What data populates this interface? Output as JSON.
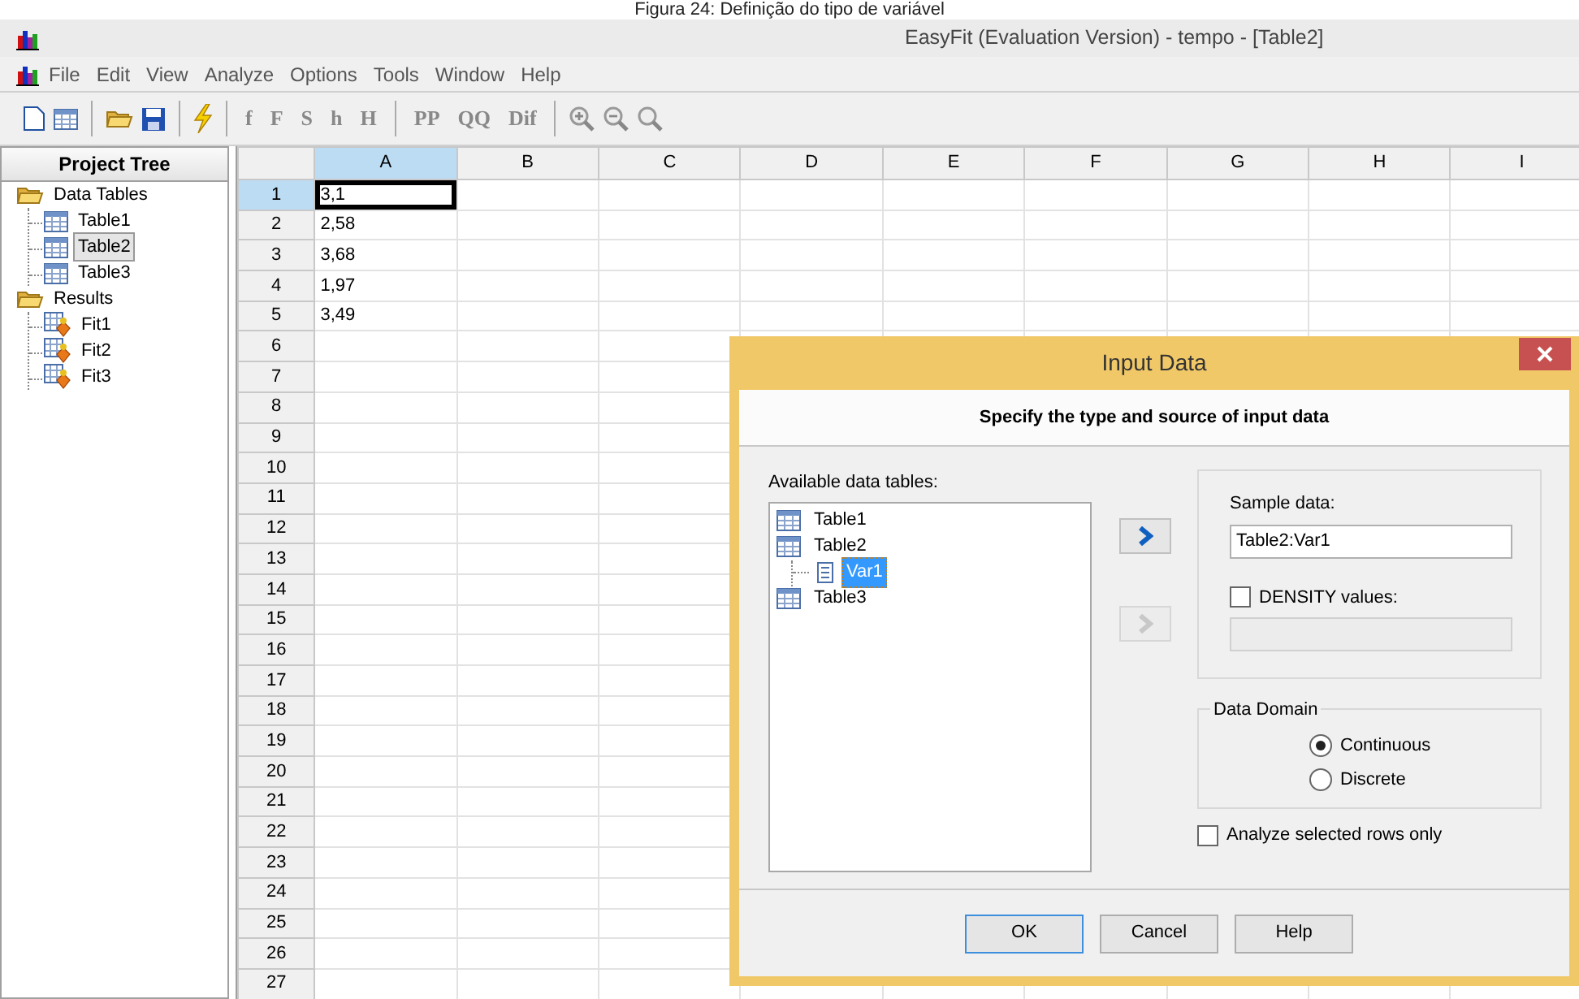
{
  "caption": "Figura 24: Definição do tipo de variável",
  "window": {
    "title": "EasyFit (Evaluation Version) - tempo - [Table2]"
  },
  "menu": [
    "File",
    "Edit",
    "View",
    "Analyze",
    "Options",
    "Tools",
    "Window",
    "Help"
  ],
  "toolbar": [
    {
      "kind": "document"
    },
    {
      "kind": "grid"
    },
    {
      "kind": "separator"
    },
    {
      "kind": "folder"
    },
    {
      "kind": "disk"
    },
    {
      "kind": "separator"
    },
    {
      "kind": "bolt"
    },
    {
      "kind": "separator"
    },
    {
      "kind": "text",
      "label": "f"
    },
    {
      "kind": "text",
      "label": "F"
    },
    {
      "kind": "text",
      "label": "S"
    },
    {
      "kind": "text",
      "label": "h"
    },
    {
      "kind": "text",
      "label": "H"
    },
    {
      "kind": "separator"
    },
    {
      "kind": "text",
      "label": "PP"
    },
    {
      "kind": "text",
      "label": "QQ"
    },
    {
      "kind": "text",
      "label": "Dif"
    },
    {
      "kind": "separator"
    },
    {
      "kind": "zoom-in"
    },
    {
      "kind": "zoom-out"
    },
    {
      "kind": "zoom"
    }
  ],
  "project_tree": {
    "title": "Project Tree",
    "items": [
      {
        "label": "Data Tables",
        "kind": "folder",
        "selected": false,
        "children": [
          {
            "label": "Table1",
            "kind": "table",
            "selected": false
          },
          {
            "label": "Table2",
            "kind": "table",
            "selected": true
          },
          {
            "label": "Table3",
            "kind": "table",
            "selected": false
          }
        ]
      },
      {
        "label": "Results",
        "kind": "folder",
        "selected": false,
        "children": [
          {
            "label": "Fit1",
            "kind": "fit",
            "selected": false
          },
          {
            "label": "Fit2",
            "kind": "fit",
            "selected": false
          },
          {
            "label": "Fit3",
            "kind": "fit",
            "selected": false
          }
        ]
      }
    ]
  },
  "grid": {
    "columns": [
      {
        "label": "A",
        "selected": true
      },
      {
        "label": "B",
        "selected": false
      },
      {
        "label": "C",
        "selected": false
      },
      {
        "label": "D",
        "selected": false
      },
      {
        "label": "E",
        "selected": false
      },
      {
        "label": "F",
        "selected": false
      },
      {
        "label": "G",
        "selected": false
      },
      {
        "label": "H",
        "selected": false
      },
      {
        "label": "I",
        "selected": false
      }
    ],
    "rows": [
      {
        "label": "1",
        "selected": true,
        "cells": [
          "3,1"
        ]
      },
      {
        "label": "2",
        "selected": false,
        "cells": [
          "2,58"
        ]
      },
      {
        "label": "3",
        "selected": false,
        "cells": [
          "3,68"
        ]
      },
      {
        "label": "4",
        "selected": false,
        "cells": [
          "1,97"
        ]
      },
      {
        "label": "5",
        "selected": false,
        "cells": [
          "3,49"
        ]
      },
      {
        "label": "6",
        "selected": false
      },
      {
        "label": "7",
        "selected": false
      },
      {
        "label": "8",
        "selected": false
      },
      {
        "label": "9",
        "selected": false
      },
      {
        "label": "10",
        "selected": false
      },
      {
        "label": "11",
        "selected": false
      },
      {
        "label": "12",
        "selected": false
      },
      {
        "label": "13",
        "selected": false
      },
      {
        "label": "14",
        "selected": false
      },
      {
        "label": "15",
        "selected": false
      },
      {
        "label": "16",
        "selected": false
      },
      {
        "label": "17",
        "selected": false
      },
      {
        "label": "18",
        "selected": false
      },
      {
        "label": "19",
        "selected": false
      },
      {
        "label": "20",
        "selected": false
      },
      {
        "label": "21",
        "selected": false
      },
      {
        "label": "22",
        "selected": false
      },
      {
        "label": "23",
        "selected": false
      },
      {
        "label": "24",
        "selected": false
      },
      {
        "label": "25",
        "selected": false
      },
      {
        "label": "26",
        "selected": false
      },
      {
        "label": "27",
        "selected": false
      }
    ]
  },
  "dialog": {
    "title": "Input Data",
    "subtitle": "Specify the type and source of input data",
    "tables_label": "Available data tables:",
    "tables": [
      {
        "label": "Table1",
        "selected": false
      },
      {
        "label": "Table2",
        "selected": false,
        "children": [
          {
            "label": "Var1",
            "selected": true
          }
        ]
      },
      {
        "label": "Table3",
        "selected": false
      }
    ],
    "arrow_buttons": [
      {
        "disabled": false
      },
      {
        "disabled": true
      }
    ],
    "sample": {
      "label": "Sample data:",
      "value": "Table2:Var1"
    },
    "density": {
      "label": "DENSITY values:",
      "checked": false,
      "field_disabled": true
    },
    "domain": {
      "title": "Data Domain",
      "options": [
        {
          "label": "Continuous",
          "selected": true
        },
        {
          "label": "Discrete",
          "selected": false
        }
      ]
    },
    "selected_rows_only": {
      "label": "Analyze selected rows only",
      "checked": false
    },
    "buttons": [
      {
        "label": "OK",
        "default": true
      },
      {
        "label": "Cancel",
        "default": false
      },
      {
        "label": "Help",
        "default": false
      }
    ]
  }
}
